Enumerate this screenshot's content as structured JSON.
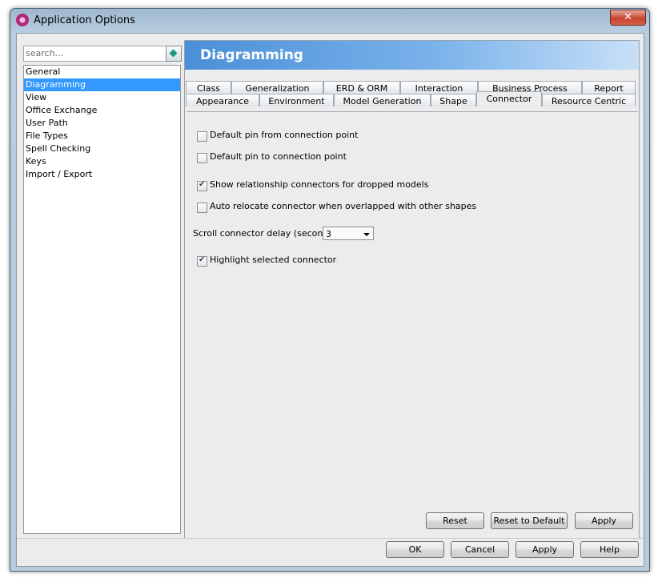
{
  "window": {
    "title": "Application Options",
    "close_glyph": "✕",
    "app_icon": "vp-logo-icon"
  },
  "sidebar": {
    "search_placeholder": "search...",
    "items": [
      {
        "label": "General"
      },
      {
        "label": "Diagramming",
        "selected": true
      },
      {
        "label": "View"
      },
      {
        "label": "Office Exchange"
      },
      {
        "label": "User Path"
      },
      {
        "label": "File Types"
      },
      {
        "label": "Spell Checking"
      },
      {
        "label": "Keys"
      },
      {
        "label": "Import / Export"
      }
    ]
  },
  "section": {
    "title": "Diagramming"
  },
  "tabs": {
    "row1": [
      "Class",
      "Generalization",
      "ERD & ORM",
      "Interaction",
      "Business Process",
      "Report"
    ],
    "row2": [
      "Appearance",
      "Environment",
      "Model Generation",
      "Shape",
      "Connector",
      "Resource Centric"
    ],
    "active": "Connector"
  },
  "options": {
    "default_pin_from": {
      "label": "Default pin from connection point",
      "checked": false
    },
    "default_pin_to": {
      "label": "Default pin to connection point",
      "checked": false
    },
    "show_rel_connectors": {
      "label": "Show relationship connectors for dropped models",
      "checked": true
    },
    "auto_relocate": {
      "label": "Auto relocate connector when overlapped with other shapes",
      "checked": false
    },
    "scroll_delay": {
      "label": "Scroll connector delay (second) :",
      "value": "3"
    },
    "highlight_selected": {
      "label": "Highlight selected connector",
      "checked": true
    }
  },
  "panel_buttons": {
    "reset": "Reset",
    "reset_default": "Reset to Default",
    "apply": "Apply"
  },
  "dialog_buttons": {
    "ok": "OK",
    "cancel": "Cancel",
    "apply": "Apply",
    "help": "Help"
  }
}
